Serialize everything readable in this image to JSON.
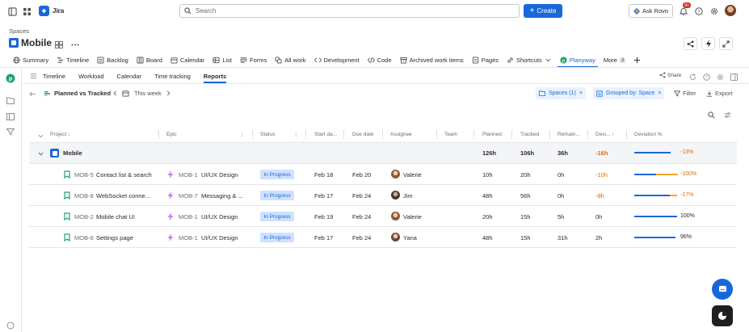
{
  "topbar": {
    "app_name": "Jira",
    "search_placeholder": "Search",
    "create_label": "Create",
    "ask_rovo_label": "Ask Rovo",
    "notification_count": "9+"
  },
  "project": {
    "breadcrumb": "Spaces",
    "title": "Mobile"
  },
  "tabs": [
    {
      "label": "Summary",
      "icon": "globe-icon"
    },
    {
      "label": "Timeline",
      "icon": "timeline-icon"
    },
    {
      "label": "Backlog",
      "icon": "backlog-icon"
    },
    {
      "label": "Board",
      "icon": "board-icon"
    },
    {
      "label": "Calendar",
      "icon": "calendar-icon"
    },
    {
      "label": "List",
      "icon": "list-icon"
    },
    {
      "label": "Forms",
      "icon": "forms-icon"
    },
    {
      "label": "All work",
      "icon": "all-work-icon"
    },
    {
      "label": "Development",
      "icon": "code-icon"
    },
    {
      "label": "Code",
      "icon": "code-icon"
    },
    {
      "label": "Archived work items",
      "icon": "archive-icon"
    },
    {
      "label": "Pages",
      "icon": "pages-icon"
    },
    {
      "label": "Shortcuts",
      "icon": "link-icon"
    },
    {
      "label": "Planyway",
      "icon": "planyway-icon"
    },
    {
      "label": "More",
      "icon": "chevron-down-icon"
    }
  ],
  "more_count": "3",
  "subnav": [
    "Timeline",
    "Workload",
    "Calendar",
    "Time tracking",
    "Reports"
  ],
  "share_label": "Share",
  "report": {
    "title": "Planned vs Tracked",
    "period": "This week",
    "chip_spaces": "Spaces (1)",
    "chip_grouped": "Grouped by: Space",
    "filter_label": "Filter",
    "export_label": "Export"
  },
  "columns": [
    "Project",
    "Epic",
    "Status",
    "Start da...",
    "Due date",
    "Assignee",
    "Team",
    "Planned",
    "Tracked",
    "Remain...",
    "Devi...",
    "Deviation %"
  ],
  "group": {
    "name": "Mobile",
    "planned": "126h",
    "tracked": "106h",
    "remaining": "36h",
    "deviation": "-16h",
    "deviation_pct": "-13%",
    "progress": 0.84,
    "over": 0
  },
  "rows": [
    {
      "key": "MOB-5",
      "name": "Contact list & search",
      "epic_key": "MOB-1",
      "epic": "UI/UX Design",
      "status": "In Progress",
      "start": "Feb 18",
      "due": "Feb 20",
      "assignee": "Valerie",
      "planned": "10h",
      "tracked": "20h",
      "remaining": "0h",
      "deviation": "-10h",
      "deviation_pct": "-100%",
      "progress": 0.5,
      "over": 0.5
    },
    {
      "key": "MOB-8",
      "name": "WebSocket conne...",
      "epic_key": "MOB-7",
      "epic": "Messaging & ...",
      "status": "In Progress",
      "start": "Feb 17",
      "due": "Feb 24",
      "assignee": "Jim",
      "planned": "48h",
      "tracked": "56h",
      "remaining": "0h",
      "deviation": "-8h",
      "deviation_pct": "-17%",
      "progress": 0.83,
      "over": 0.17
    },
    {
      "key": "MOB-2",
      "name": "Mobile chat UI",
      "epic_key": "MOB-1",
      "epic": "UI/UX Design",
      "status": "In Progress",
      "start": "Feb 19",
      "due": "Feb 24",
      "assignee": "Valerie",
      "planned": "20h",
      "tracked": "15h",
      "remaining": "5h",
      "deviation": "0h",
      "deviation_pct": "100%",
      "progress": 1.0,
      "over": 0
    },
    {
      "key": "MOB-6",
      "name": "Settings page",
      "epic_key": "MOB-1",
      "epic": "UI/UX Design",
      "status": "In Progress",
      "start": "Feb 17",
      "due": "Feb 24",
      "assignee": "Yana",
      "planned": "48h",
      "tracked": "15h",
      "remaining": "31h",
      "deviation": "2h",
      "deviation_pct": "96%",
      "progress": 0.96,
      "over": 0
    }
  ],
  "colors": {
    "accent": "#1868db",
    "warning": "#e06c00",
    "danger": "#c9372c",
    "planyway": "#22a06b"
  }
}
